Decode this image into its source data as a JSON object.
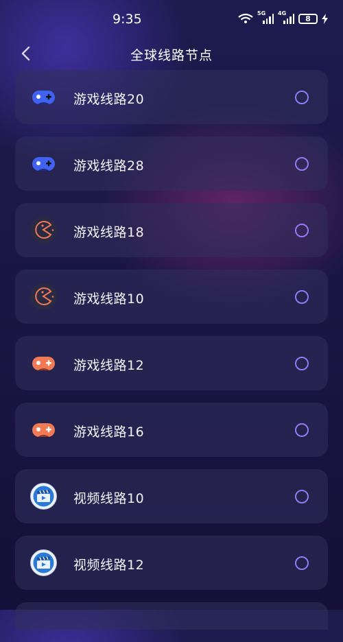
{
  "status_bar": {
    "time": "9:35",
    "signal1_label": "5G",
    "signal2_label": "4G",
    "battery": "8",
    "icons": [
      "wifi-icon",
      "signal-5g-icon",
      "signal-4g-icon",
      "battery-icon",
      "charging-icon"
    ]
  },
  "header": {
    "back_icon": "chevron-left-icon",
    "title": "全球线路节点"
  },
  "nodes": [
    {
      "label": "游戏线路20",
      "icon": "blue-gamepad-icon",
      "selected": false
    },
    {
      "label": "游戏线路28",
      "icon": "blue-gamepad-icon",
      "selected": false
    },
    {
      "label": "游戏线路18",
      "icon": "pacman-icon",
      "selected": false
    },
    {
      "label": "游戏线路10",
      "icon": "pacman-icon",
      "selected": false
    },
    {
      "label": "游戏线路12",
      "icon": "orange-gamepad-icon",
      "selected": false
    },
    {
      "label": "游戏线路16",
      "icon": "orange-gamepad-icon",
      "selected": false
    },
    {
      "label": "视频线路10",
      "icon": "video-clapper-icon",
      "selected": false
    },
    {
      "label": "视频线路12",
      "icon": "video-clapper-icon",
      "selected": false
    }
  ],
  "colors": {
    "radio": "#8f7cf2",
    "gamepad_blue": "#3f63f0",
    "gamepad_orange": "#f07a54",
    "pacman": "#f07a54",
    "card": "#2e2c5c"
  }
}
